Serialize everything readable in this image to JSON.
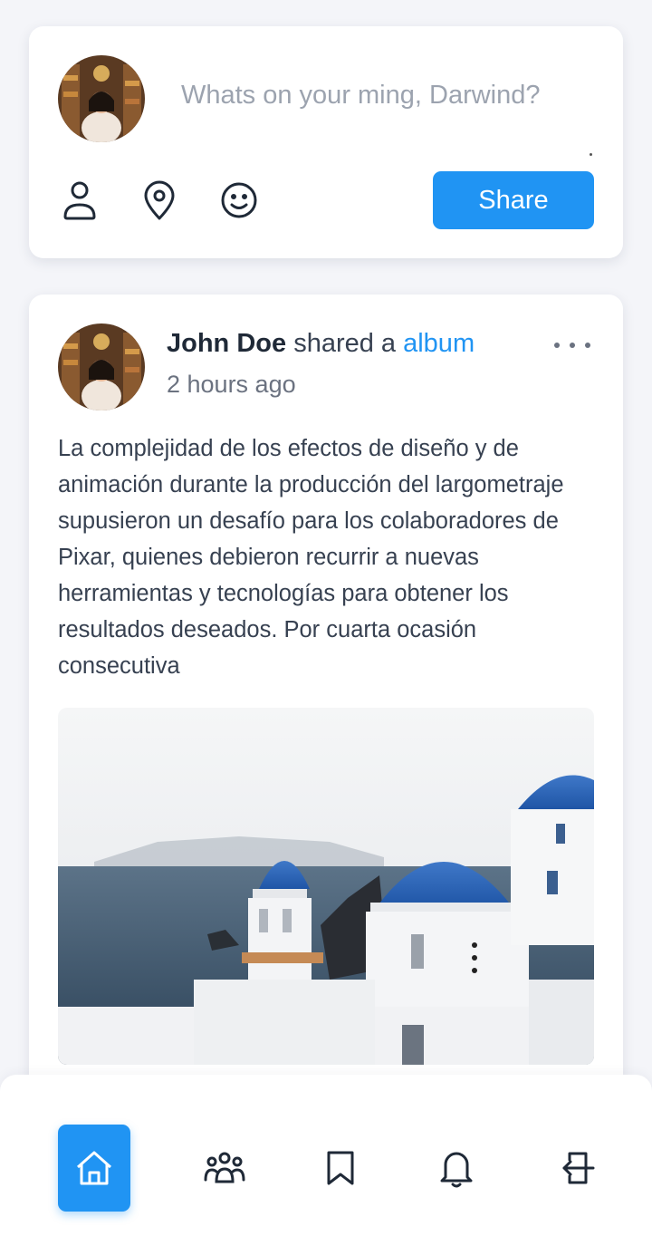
{
  "composer": {
    "placeholder": "Whats on your ming, Darwind?",
    "share_label": "Share",
    "tools": [
      "person-icon",
      "location-pin-icon",
      "smiley-icon"
    ]
  },
  "post": {
    "author": "John Doe",
    "action": "shared a",
    "link_text": "album",
    "time": "2 hours ago",
    "text": "La complejidad de los efectos de diseño y de animación durante la producción del largometraje supusieron un desafío para los colaboradores de Pixar, quienes debieron recurrir a nuevas herramientas y tecnologías para obtener los resultados deseados. Por cuarta ocasión consecutiva"
  },
  "bottom_nav": {
    "items": [
      "home-icon",
      "people-icon",
      "bookmark-icon",
      "bell-icon",
      "logout-icon"
    ],
    "active": "home-icon"
  },
  "colors": {
    "accent": "#2094f3",
    "background": "#f4f5f9",
    "text": "#374151",
    "muted": "#6b7280"
  }
}
